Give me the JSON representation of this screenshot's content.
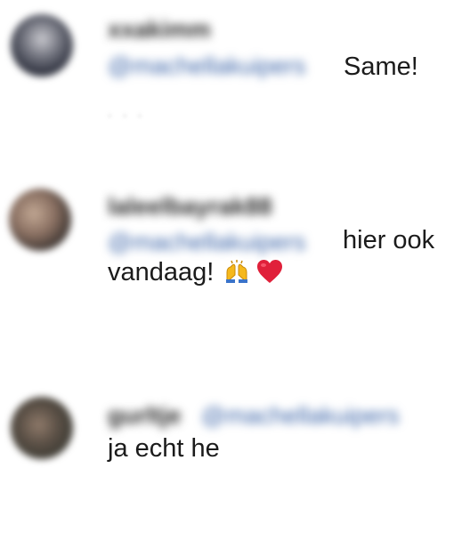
{
  "comments": [
    {
      "username": "xxakimm",
      "mention": "@machellakuipers",
      "text_line1": "Same!",
      "more": ". . ."
    },
    {
      "username": "laleelbayrak88",
      "mention": "@machellakuipers",
      "text_line1": "hier ook",
      "text_line2": "vandaag!"
    },
    {
      "username": "gurltje",
      "mention": "@machellakuipers",
      "text_line1": "ja echt he"
    }
  ],
  "colors": {
    "mention": "#3b64a8",
    "text": "#1b1b1b",
    "heart": "#e0203a",
    "hands": "#f5b81c"
  },
  "icons": {
    "emoji1": "raised-hands-emoji",
    "emoji2": "red-heart-emoji"
  }
}
